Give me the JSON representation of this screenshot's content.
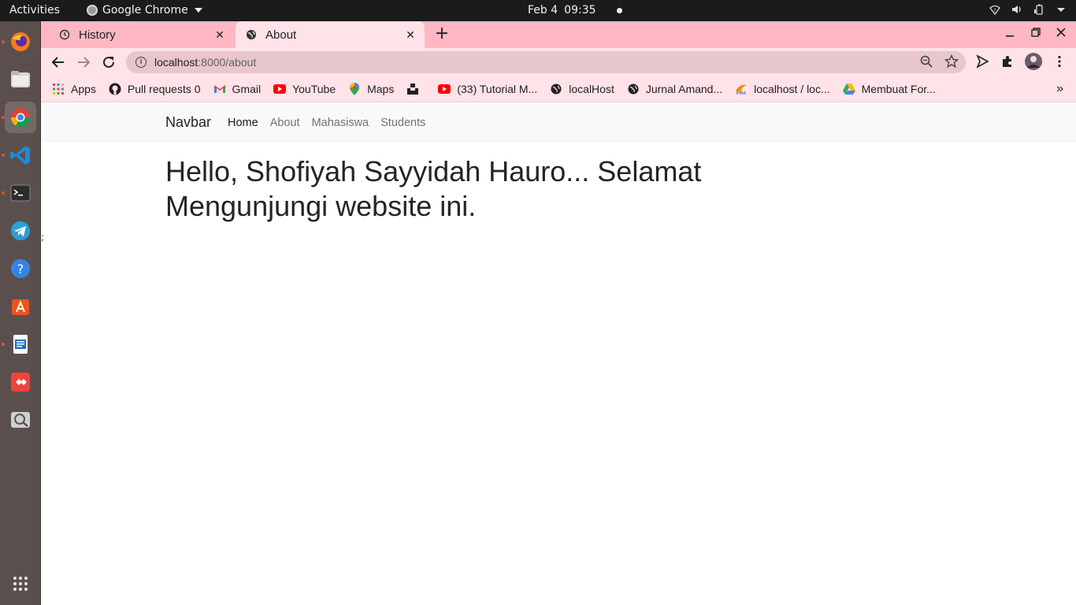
{
  "topbar": {
    "activities": "Activities",
    "app_name": "Google Chrome",
    "date": "Feb 4",
    "time": "09:35"
  },
  "dock": {
    "items": [
      "firefox",
      "files",
      "chrome",
      "vscode",
      "terminal",
      "telegram",
      "help",
      "software-center",
      "libreoffice-writer",
      "anydesk",
      "screenshot"
    ]
  },
  "browser": {
    "tabs": [
      {
        "title": "History",
        "icon": "history-icon"
      },
      {
        "title": "About",
        "icon": "globe-icon"
      }
    ],
    "url_host": "localhost",
    "url_path": ":8000/about",
    "bookmarks": [
      {
        "label": "Apps",
        "icon": "apps-grid-icon"
      },
      {
        "label": "Pull requests 0",
        "icon": "github-icon"
      },
      {
        "label": "Gmail",
        "icon": "gmail-icon"
      },
      {
        "label": "YouTube",
        "icon": "youtube-icon"
      },
      {
        "label": "Maps",
        "icon": "maps-pin-icon"
      },
      {
        "label": "",
        "icon": "unsplash-icon"
      },
      {
        "label": "(33) Tutorial M...",
        "icon": "youtube-icon"
      },
      {
        "label": "localHost",
        "icon": "globe-icon"
      },
      {
        "label": "Jurnal Amand...",
        "icon": "globe-icon"
      },
      {
        "label": "localhost / loc...",
        "icon": "phpmyadmin-icon"
      },
      {
        "label": "Membuat For...",
        "icon": "drive-icon"
      }
    ],
    "bookmarks_more": "»"
  },
  "page": {
    "navbar": {
      "brand": "Navbar",
      "links": [
        "Home",
        "About",
        "Mahasiswa",
        "Students"
      ]
    },
    "heading": "Hello, Shofiyah Sayyidah Hauro... Selamat Mengunjungi website ini.",
    "stray": ";"
  },
  "colors": {
    "tabstrip": "#ffb7c4",
    "toolbar": "#ffe3e8",
    "dock": "#5b4f4d",
    "topbar": "#1b1b1b"
  }
}
